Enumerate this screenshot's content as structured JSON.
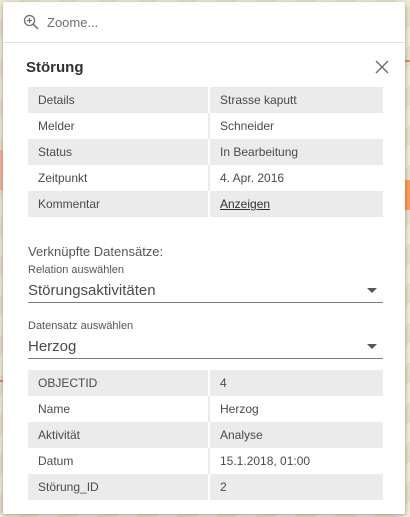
{
  "zoom": {
    "label": "Zoome..."
  },
  "popup": {
    "title": "Störung",
    "close_icon": "close-icon"
  },
  "attributes": [
    {
      "key": "Details",
      "value": "Strasse kaputt"
    },
    {
      "key": "Melder",
      "value": "Schneider"
    },
    {
      "key": "Status",
      "value": "In Bearbeitung"
    },
    {
      "key": "Zeitpunkt",
      "value": "4. Apr. 2016"
    },
    {
      "key": "Kommentar",
      "value": "Anzeigen"
    }
  ],
  "related": {
    "title": "Verknüpfte Datensätze:",
    "relation_label": "Relation auswählen",
    "relation_value": "Störungsaktivitäten",
    "record_label": "Datensatz auswählen",
    "record_value": "Herzog"
  },
  "related_attributes": [
    {
      "key": "OBJECTID",
      "value": "4"
    },
    {
      "key": "Name",
      "value": "Herzog"
    },
    {
      "key": "Aktivität",
      "value": "Analyse"
    },
    {
      "key": "Datum",
      "value": "15.1.2018, 01:00"
    },
    {
      "key": "Störung_ID",
      "value": "2"
    }
  ]
}
